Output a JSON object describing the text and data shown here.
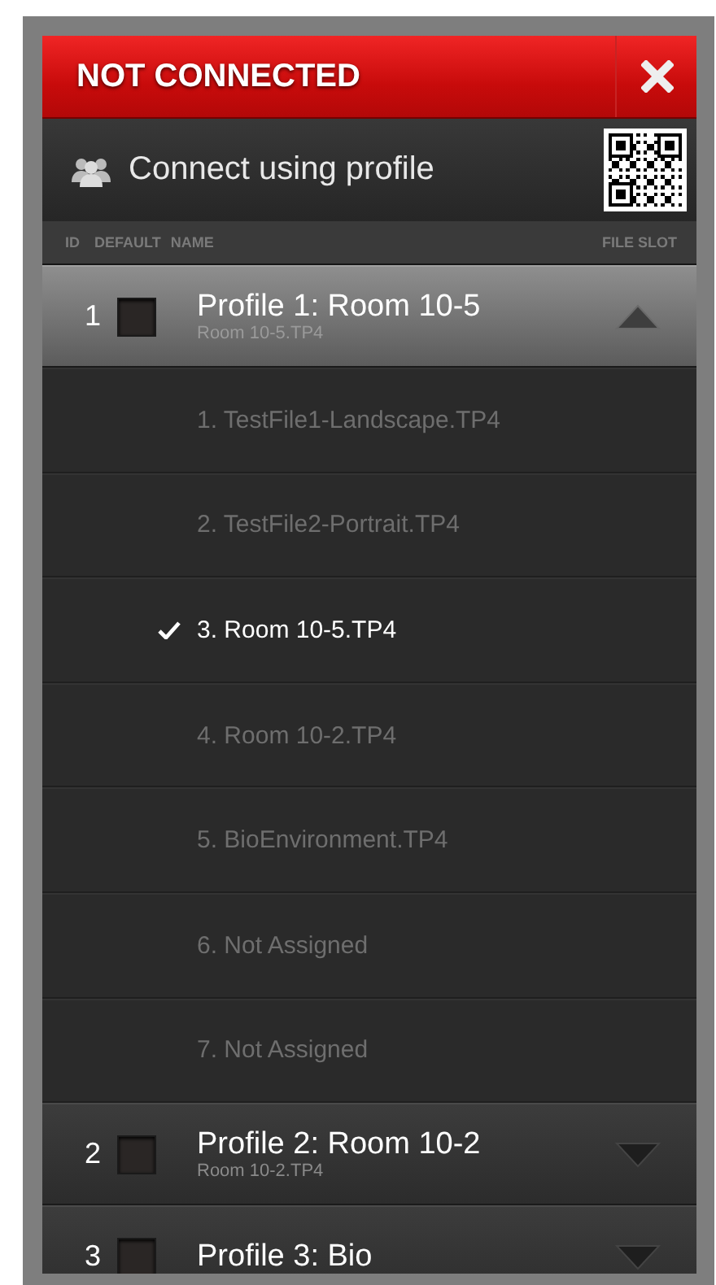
{
  "header": {
    "title": "NOT CONNECTED"
  },
  "connect": {
    "label": "Connect using profile"
  },
  "columns": [
    "ID",
    "DEFAULT",
    "NAME",
    "FILE SLOT"
  ],
  "profiles": [
    {
      "id": "1",
      "name": "Profile 1: Room 10-5",
      "file": "Room 10-5.TP4",
      "default": false,
      "expanded": true,
      "slots": [
        {
          "label": "1. TestFile1-Landscape.TP4",
          "selected": false
        },
        {
          "label": "2. TestFile2-Portrait.TP4",
          "selected": false
        },
        {
          "label": "3. Room 10-5.TP4",
          "selected": true
        },
        {
          "label": "4. Room 10-2.TP4",
          "selected": false
        },
        {
          "label": "5. BioEnvironment.TP4",
          "selected": false
        },
        {
          "label": "6. Not Assigned",
          "selected": false
        },
        {
          "label": "7. Not Assigned",
          "selected": false
        }
      ]
    },
    {
      "id": "2",
      "name": "Profile 2: Room 10-2",
      "file": "Room 10-2.TP4",
      "default": false,
      "expanded": false
    },
    {
      "id": "3",
      "name": "Profile 3: Bio",
      "default": false,
      "expanded": false
    }
  ]
}
